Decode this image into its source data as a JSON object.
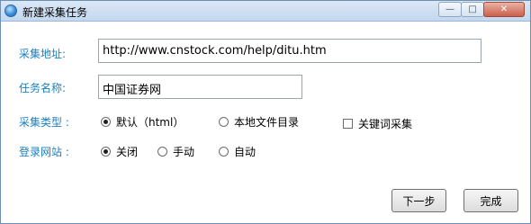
{
  "window": {
    "title": "新建采集任务",
    "controls": {
      "minimize": "—",
      "maximize": "□",
      "close": "✕"
    }
  },
  "form": {
    "url_label": "采集地址:",
    "url_value": "http://www.cnstock.com/help/ditu.htm",
    "name_label": "任务名称:",
    "name_value": "中国证券网",
    "type_label": "采集类型 :",
    "type_options": [
      {
        "label": "默认（html）",
        "checked": true
      },
      {
        "label": "本地文件目录",
        "checked": false
      }
    ],
    "keyword_label": "关键词采集",
    "keyword_checked": false,
    "login_label": "登录网站 :",
    "login_options": [
      {
        "label": "关闭",
        "checked": true
      },
      {
        "label": "手动",
        "checked": false
      },
      {
        "label": "自动",
        "checked": false
      }
    ]
  },
  "buttons": {
    "next": "下一步",
    "finish": "完成"
  }
}
